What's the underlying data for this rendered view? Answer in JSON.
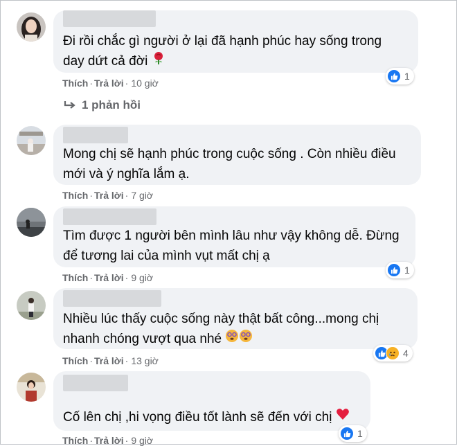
{
  "labels": {
    "like": "Thích",
    "reply": "Trả lời",
    "separator": "·"
  },
  "comments": [
    {
      "text_lines": [
        "Đi rồi chắc gì người ở lại đã hạnh phúc hay sống trong",
        "day dứt cả đời"
      ],
      "trailing_emoji": "rose",
      "time": "10 giờ",
      "reactions": {
        "types": [
          "like"
        ],
        "count": "1"
      }
    },
    {
      "text_lines": [
        "Mong chị sẽ hạnh phúc trong cuộc sống . Còn nhiều điều",
        "mới và ý nghĩa lắm ạ."
      ],
      "time": "7 giờ"
    },
    {
      "text_lines": [
        "Tìm được 1 người bên mình lâu như vậy không dễ. Đừng",
        "để tương lai của mình vụt mất chị ạ"
      ],
      "time": "9 giờ",
      "reactions": {
        "types": [
          "like"
        ],
        "count": "1"
      }
    },
    {
      "text_lines": [
        "Nhiều lúc thấy cuộc sống này thật bất công...mong chị",
        "nhanh chóng vượt qua nhé"
      ],
      "trailing_emoji": "two-dizzy-faces",
      "time": "13 giờ",
      "reactions": {
        "types": [
          "like",
          "sad"
        ],
        "count": "4"
      }
    },
    {
      "text_lines": [
        "Cố lên chị ,hi vọng điều tốt lành sẽ đến với chị"
      ],
      "trailing_emoji": "red-heart",
      "time": "9 giờ",
      "reactions": {
        "types": [
          "like"
        ],
        "count": "1"
      }
    }
  ],
  "replies_link": "1 phản hồi",
  "colors": {
    "bubble": "#f0f2f5",
    "meta_text": "#65676b",
    "like_blue": "#1877f2",
    "sad_yellow": "#f7b125",
    "heart_red": "#e41e3f"
  }
}
